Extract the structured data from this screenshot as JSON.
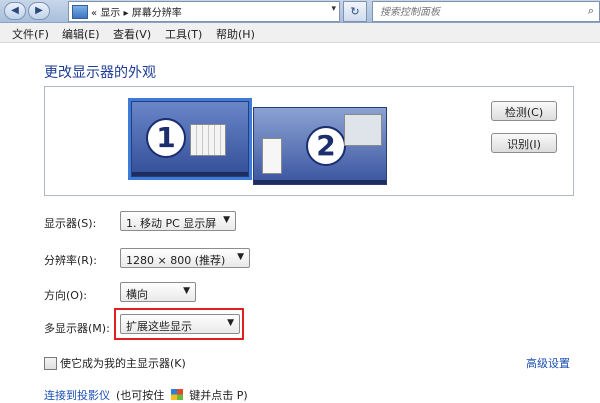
{
  "window": {
    "address": {
      "path": [
        "显示",
        "屏幕分辨率"
      ],
      "separator": "▸",
      "prefix": "«"
    },
    "search": {
      "placeholder": "搜索控制面板"
    },
    "menubar": {
      "items": [
        "文件(F)",
        "编辑(E)",
        "查看(V)",
        "工具(T)",
        "帮助(H)"
      ]
    }
  },
  "page": {
    "title": "更改显示器的外观",
    "monitors": [
      {
        "number": "1",
        "selected": true
      },
      {
        "number": "2",
        "selected": false
      }
    ],
    "detect_button": "检测(C)",
    "identify_button": "识别(I)",
    "fields": {
      "display": {
        "label": "显示器(S):",
        "value": "1. 移动 PC 显示屏"
      },
      "resolution": {
        "label": "分辨率(R):",
        "value": "1280 × 800 (推荐)"
      },
      "orientation": {
        "label": "方向(O):",
        "value": "横向"
      },
      "multiple_displays": {
        "label": "多显示器(M):",
        "value": "扩展这些显示"
      }
    },
    "make_main_checkbox": {
      "label": "使它成为我的主显示器(K)",
      "checked": false
    },
    "advanced_link": "高级设置",
    "projector_link": "连接到投影仪",
    "projector_hint_before": "(也可按住",
    "projector_hint_after": "键并点击 P)"
  },
  "colors": {
    "title": "#1e3d96",
    "link": "#1a4fb5",
    "highlight_box": "#e02020",
    "selected_monitor_outline": "#3d7bd8"
  }
}
